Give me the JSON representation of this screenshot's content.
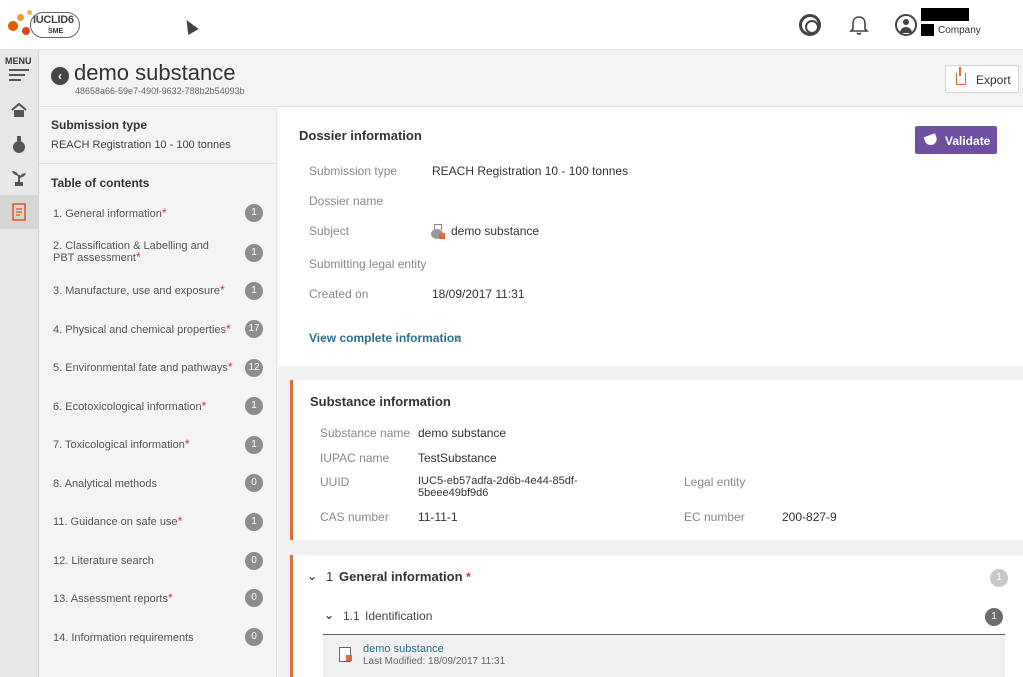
{
  "topbar": {
    "logo_text": "IUCLID6",
    "logo_sub": "SME",
    "company": "Company"
  },
  "rail": {
    "menu_label": "MENU"
  },
  "header": {
    "title": "demo substance",
    "uuid": "48658a66-59e7-490f-9632-788b2b54093b",
    "export_label": "Export"
  },
  "side": {
    "submission_type_title": "Submission type",
    "submission_type_value": "REACH Registration 10 - 100 tonnes",
    "toc_title": "Table of contents",
    "toc": [
      {
        "label": "1. General information",
        "required": "*",
        "count": "1"
      },
      {
        "label": "2. Classification & Labelling and PBT assessment",
        "required": "*",
        "count": "1"
      },
      {
        "label": "3. Manufacture, use and exposure",
        "required": "*",
        "count": "1"
      },
      {
        "label": "4. Physical and chemical properties",
        "required": "*",
        "count": "17"
      },
      {
        "label": "5. Environmental fate and pathways",
        "required": "*",
        "count": "12"
      },
      {
        "label": "6. Ecotoxicological information",
        "required": "*",
        "count": "1"
      },
      {
        "label": "7. Toxicological information",
        "required": "*",
        "count": "1"
      },
      {
        "label": "8. Analytical methods",
        "required": "",
        "count": "0"
      },
      {
        "label": "11. Guidance on safe use",
        "required": "*",
        "count": "1"
      },
      {
        "label": "12. Literature search",
        "required": "",
        "count": "0"
      },
      {
        "label": "13. Assessment reports",
        "required": "*",
        "count": "0"
      },
      {
        "label": "14. Information requirements",
        "required": "",
        "count": "0"
      }
    ]
  },
  "dossier": {
    "title": "Dossier information",
    "validate_label": "Validate",
    "fields": {
      "submission_type_label": "Submission type",
      "submission_type_value": "REACH Registration 10 - 100 tonnes",
      "dossier_name_label": "Dossier name",
      "subject_label": "Subject",
      "subject_value": "demo substance",
      "legal_entity_label": "Submitting legal entity",
      "created_on_label": "Created on",
      "created_on_value": "18/09/2017 11:31"
    },
    "view_link": "View complete information"
  },
  "substance": {
    "title": "Substance information",
    "name_label": "Substance name",
    "name_value": "demo substance",
    "iupac_label": "IUPAC name",
    "iupac_value": "TestSubstance",
    "uuid_label": "UUID",
    "uuid_value_line1": "IUC5-eb57adfa-2d6b-4e44-85df-",
    "uuid_value_line2": "5beee49bf9d6",
    "legal_entity_label": "Legal entity",
    "cas_label": "CAS number",
    "cas_value": "11-11-1",
    "ec_label": "EC number",
    "ec_value": "200-827-9"
  },
  "general": {
    "number": "1",
    "title": "General information",
    "required": "*",
    "count": "1",
    "sub": {
      "number": "1.1",
      "title": "Identification",
      "count": "1",
      "doc_name": "demo substance",
      "doc_meta": "Last Modified: 18/09/2017 11:31"
    }
  },
  "colors": {
    "accent": "#e06a3c",
    "validate": "#6f4fa0",
    "link": "#2a7090"
  }
}
